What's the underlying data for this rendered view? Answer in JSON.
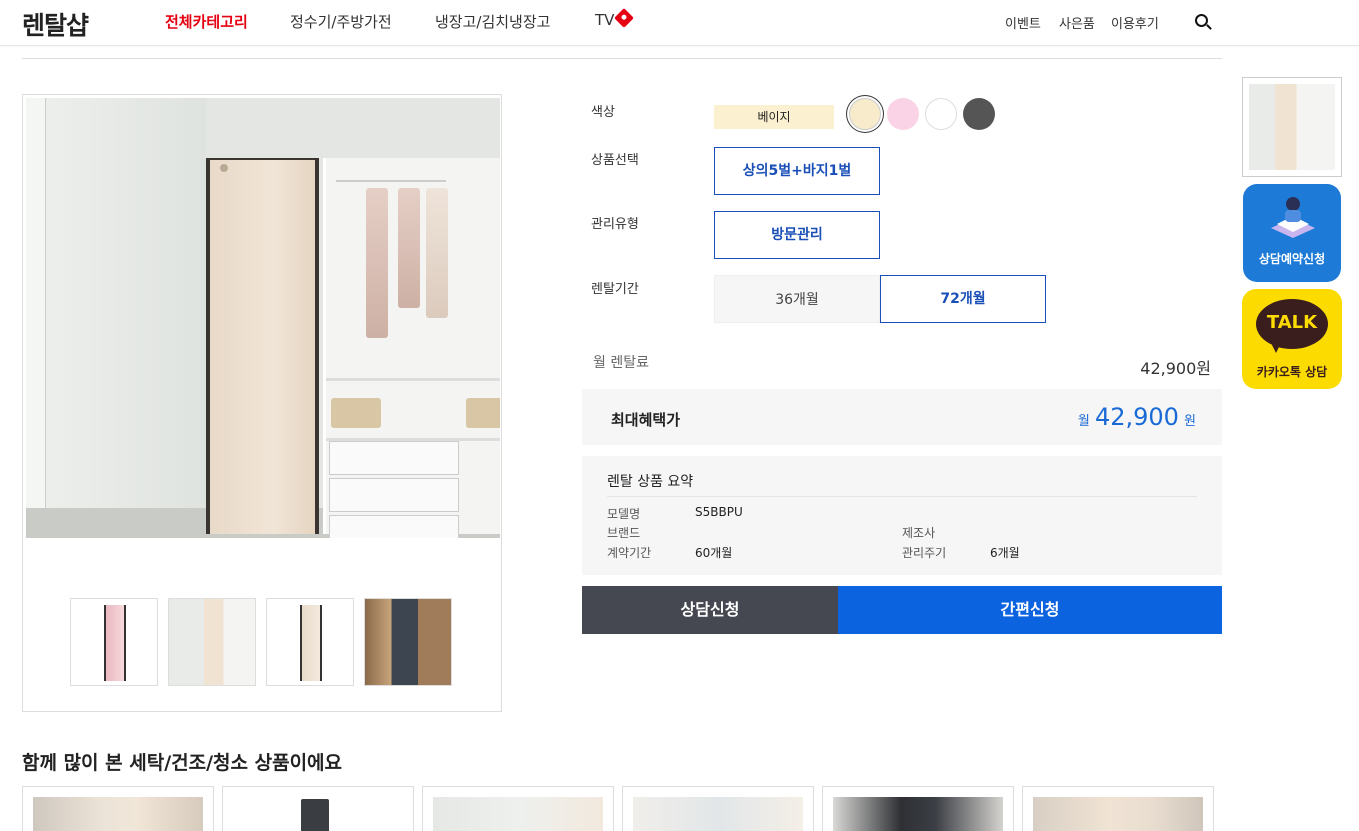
{
  "header": {
    "logo": "렌탈샵",
    "nav": [
      {
        "label": "전체카테고리",
        "active": true
      },
      {
        "label": "정수기/주방가전",
        "active": false
      },
      {
        "label": "냉장고/김치냉장고",
        "active": false
      },
      {
        "label": "TV",
        "active": false
      }
    ],
    "utils": [
      "이벤트",
      "사은품",
      "이용후기"
    ],
    "accent": "#e50012"
  },
  "options": {
    "color_label": "색상",
    "color_selected": "베이지",
    "swatches": [
      {
        "name": "beige",
        "hex": "#f7ebcc",
        "selected": true
      },
      {
        "name": "pink",
        "hex": "#fbd3e6",
        "selected": false
      },
      {
        "name": "white",
        "hex": "#ffffff",
        "selected": false
      },
      {
        "name": "dark-gray",
        "hex": "#555555",
        "selected": false
      }
    ],
    "product_label": "상품선택",
    "product_value": "상의5벌+바지1벌",
    "care_label": "관리유형",
    "care_value": "방문관리",
    "period_label": "렌탈기간",
    "periods": [
      {
        "label": "36개월",
        "selected": false
      },
      {
        "label": "72개월",
        "selected": true
      }
    ]
  },
  "pricing": {
    "monthly_label": "월 렌탈료",
    "monthly_value": "42,900원",
    "benefit_label": "최대혜택가",
    "benefit_prefix": "월",
    "benefit_value": "42,900",
    "benefit_suffix": "원"
  },
  "summary": {
    "title": "렌탈 상품 요약",
    "model_key": "모델명",
    "model_val": "S5BBPU",
    "brand_key": "브랜드",
    "brand_val": "",
    "maker_key": "제조사",
    "maker_val": "",
    "contract_key": "계약기간",
    "contract_val": "60개월",
    "cycle_key": "관리주기",
    "cycle_val": "6개월"
  },
  "actions": {
    "consult": "상담신청",
    "easy": "간편신청"
  },
  "side": {
    "consult_label": "상담예약신청",
    "kakao_bubble": "TALK",
    "kakao_label": "카카오톡 상담"
  },
  "related": {
    "title": "함께 많이 본 세탁/건조/청소 상품이에요"
  }
}
